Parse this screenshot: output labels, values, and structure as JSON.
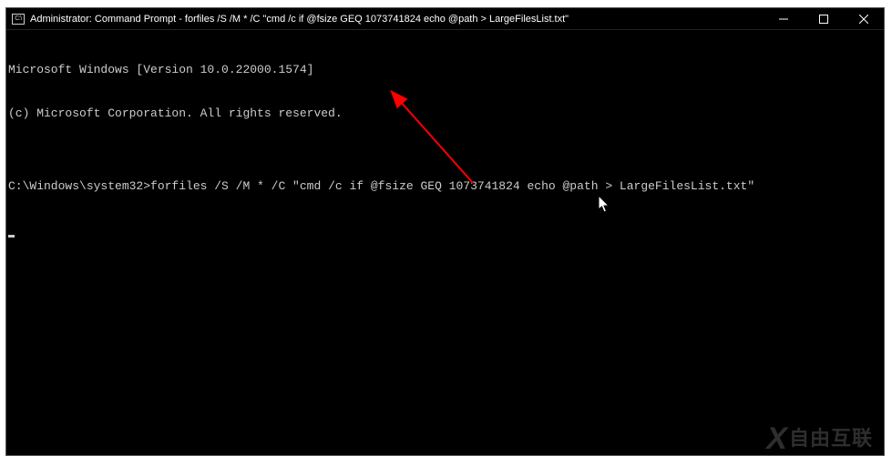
{
  "window": {
    "title": "Administrator: Command Prompt - forfiles  /S /M * /C \"cmd /c if @fsize GEQ 1073741824 echo @path > LargeFilesList.txt\"",
    "icon_label": "C:\\"
  },
  "terminal": {
    "line1": "Microsoft Windows [Version 10.0.22000.1574]",
    "line2": "(c) Microsoft Corporation. All rights reserved.",
    "blank": "",
    "prompt": "C:\\Windows\\system32>",
    "command": "forfiles /S /M * /C \"cmd /c if @fsize GEQ 1073741824 echo @path > LargeFilesList.txt\""
  },
  "watermark": {
    "x": "X",
    "text": "自由互联"
  }
}
